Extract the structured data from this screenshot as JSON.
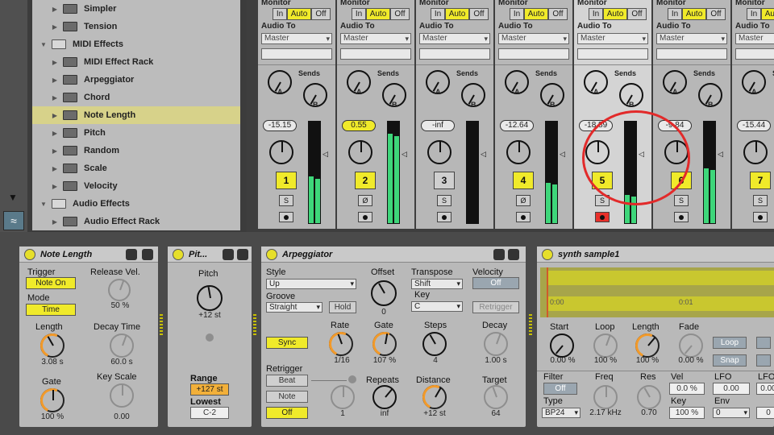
{
  "browser": {
    "items": [
      {
        "label": "Simpler",
        "indent": 2,
        "type": "folder-closed",
        "selected": false
      },
      {
        "label": "Tension",
        "indent": 2,
        "type": "folder-closed",
        "selected": false
      },
      {
        "label": "MIDI Effects",
        "indent": 1,
        "type": "folder-open",
        "selected": false
      },
      {
        "label": "MIDI Effect Rack",
        "indent": 2,
        "type": "folder-closed",
        "selected": false
      },
      {
        "label": "Arpeggiator",
        "indent": 2,
        "type": "folder-closed",
        "selected": false
      },
      {
        "label": "Chord",
        "indent": 2,
        "type": "folder-closed",
        "selected": false
      },
      {
        "label": "Note Length",
        "indent": 2,
        "type": "folder-closed",
        "selected": true
      },
      {
        "label": "Pitch",
        "indent": 2,
        "type": "folder-closed",
        "selected": false
      },
      {
        "label": "Random",
        "indent": 2,
        "type": "folder-closed",
        "selected": false
      },
      {
        "label": "Scale",
        "indent": 2,
        "type": "folder-closed",
        "selected": false
      },
      {
        "label": "Velocity",
        "indent": 2,
        "type": "folder-closed",
        "selected": false
      },
      {
        "label": "Audio Effects",
        "indent": 1,
        "type": "folder-open",
        "selected": false
      },
      {
        "label": "Audio Effect Rack",
        "indent": 2,
        "type": "folder-closed",
        "selected": false
      }
    ]
  },
  "mixer": {
    "labels": {
      "monitor": "Monitor",
      "in": "In",
      "auto": "Auto",
      "off": "Off",
      "audio_to": "Audio To",
      "sends": "Sends",
      "send_a": "A",
      "send_b": "B",
      "solo": "S"
    },
    "tracks": [
      {
        "num": "1",
        "volume": "-15.15",
        "routing": "Master",
        "meter_l": 0.46,
        "meter_r": 0.44,
        "vol_highlight": false,
        "num_on": true,
        "armed": false,
        "highlight": false,
        "solo_symbol": "S"
      },
      {
        "num": "2",
        "volume": "0.55",
        "routing": "Master",
        "meter_l": 0.88,
        "meter_r": 0.86,
        "vol_highlight": true,
        "num_on": true,
        "armed": false,
        "highlight": false,
        "solo_symbol": "Ø"
      },
      {
        "num": "3",
        "volume": "-inf",
        "routing": "Master",
        "meter_l": 0.0,
        "meter_r": 0.0,
        "vol_highlight": false,
        "num_on": false,
        "armed": false,
        "highlight": false,
        "solo_symbol": "S"
      },
      {
        "num": "4",
        "volume": "-12.64",
        "routing": "Master",
        "meter_l": 0.4,
        "meter_r": 0.38,
        "vol_highlight": false,
        "num_on": true,
        "armed": false,
        "highlight": false,
        "solo_symbol": "Ø"
      },
      {
        "num": "5",
        "volume": "-18.89",
        "routing": "Master",
        "meter_l": 0.28,
        "meter_r": 0.26,
        "vol_highlight": false,
        "num_on": true,
        "armed": true,
        "highlight": true,
        "solo_symbol": "S"
      },
      {
        "num": "6",
        "volume": "-9.84",
        "routing": "Master",
        "meter_l": 0.54,
        "meter_r": 0.52,
        "vol_highlight": false,
        "num_on": true,
        "armed": false,
        "highlight": false,
        "solo_symbol": "S"
      },
      {
        "num": "7",
        "volume": "-15.44",
        "routing": "Master",
        "meter_l": 0.34,
        "meter_r": 0.32,
        "vol_highlight": false,
        "num_on": true,
        "armed": false,
        "highlight": false,
        "solo_symbol": "S"
      }
    ]
  },
  "note_length": {
    "title": "Note Length",
    "trigger_label": "Trigger",
    "trigger_value": "Note On",
    "mode_label": "Mode",
    "mode_value": "Time",
    "release_vel_label": "Release Vel.",
    "release_vel_value": "50 %",
    "length_label": "Length",
    "length_value": "3.08 s",
    "decay_time_label": "Decay Time",
    "decay_time_value": "60.0 s",
    "gate_label": "Gate",
    "gate_value": "100 %",
    "key_scale_label": "Key Scale",
    "key_scale_value": "0.00"
  },
  "pitch": {
    "title": "Pit...",
    "pitch_label": "Pitch",
    "pitch_value": "+12 st",
    "range_label": "Range",
    "range_value": "+127 st",
    "lowest_label": "Lowest",
    "lowest_value": "C-2"
  },
  "arpeggiator": {
    "title": "Arpeggiator",
    "style_label": "Style",
    "style_value": "Up",
    "groove_label": "Groove",
    "groove_value": "Straight",
    "hold_label": "Hold",
    "offset_label": "Offset",
    "offset_value": "0",
    "transpose_label": "Transpose",
    "transpose_value": "Shift",
    "key_label": "Key",
    "key_value": "C",
    "velocity_label": "Velocity",
    "velocity_value": "Off",
    "retrigger_btn_label": "Retrigger",
    "sync_label": "Sync",
    "rate_label": "Rate",
    "rate_value": "1/16",
    "gate_label": "Gate",
    "gate_value": "107 %",
    "steps_label": "Steps",
    "steps_value": "4",
    "decay_label": "Decay",
    "decay_value": "1.00 s",
    "retrigger_label": "Retrigger",
    "beat_label": "Beat",
    "note_label": "Note",
    "off_label": "Off",
    "repeats_label": "Repeats",
    "repeats_value": "inf",
    "repeat_knob_value": "1",
    "distance_label": "Distance",
    "distance_value": "+12 st",
    "target_label": "Target",
    "target_value": "64"
  },
  "simpler": {
    "title": "synth sample1",
    "ruler_left": "0:00",
    "ruler_mid": "0:01",
    "start_label": "Start",
    "start_value": "0.00 %",
    "loop_label": "Loop",
    "loop_value": "100 %",
    "length_label": "Length",
    "length_value": "100 %",
    "fade_label": "Fade",
    "fade_value": "0.00 %",
    "loop_btn": "Loop",
    "snap_btn": "Snap",
    "filter_label": "Filter",
    "filter_value": "Off",
    "type_label": "Type",
    "type_value": "BP24",
    "freq_label": "Freq",
    "freq_value": "2.17 kHz",
    "res_label": "Res",
    "res_value": "0.70",
    "vel_label": "Vel",
    "vel_value": "0.0 %",
    "key_label": "Key",
    "key_value": "100 %",
    "lfo_label": "LFO",
    "lfo_value": "0.00",
    "env_label": "Env",
    "env_value": "0",
    "lfo2_label": "LFO",
    "lfo2_value": "0.00",
    "key2_value": "0"
  },
  "colors": {
    "accent_yellow": "#f0ea2a",
    "meter_green": "#3ed67a",
    "knob_orange": "#f29a2a",
    "arm_red": "#e8302a",
    "annotation_red": "#e22a2a",
    "selection": "#d7d28a"
  }
}
